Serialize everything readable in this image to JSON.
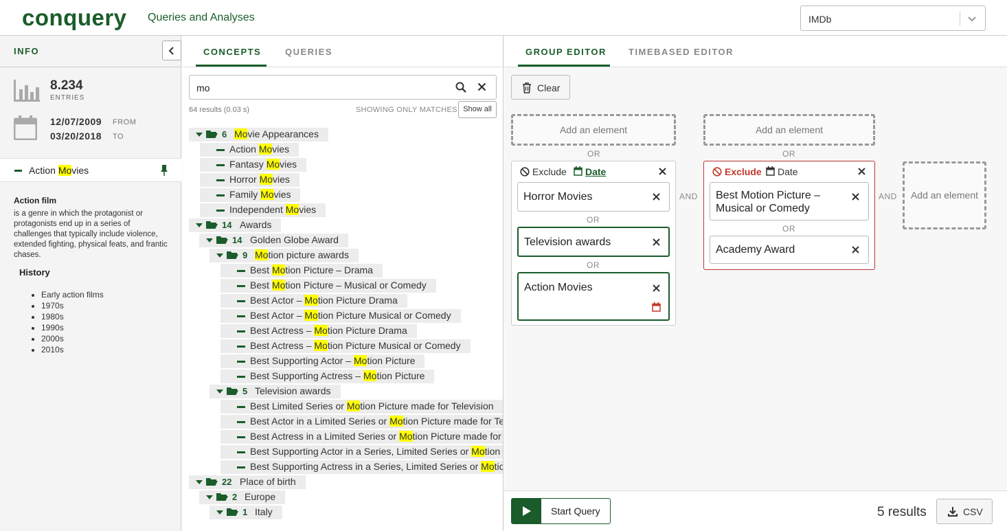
{
  "header": {
    "logo": "conquery",
    "title": "Queries and Analyses",
    "dataset": "IMDb"
  },
  "info": {
    "title": "INFO",
    "entries_value": "8.234",
    "entries_label": "ENTRIES",
    "date_from": "12/07/2009",
    "date_from_label": "FROM",
    "date_to": "03/20/2018",
    "date_to_label": "TO",
    "concept_pre": "Action ",
    "concept_hl": "Mo",
    "concept_post": "vies",
    "desc_title": "Action film",
    "desc_text": "is a genre in which the protagonist or protagonists end up in a series of challenges that typically include violence, extended fighting, physical feats, and frantic chases.",
    "history_title": "History",
    "history_items": [
      "Early action films",
      "1970s",
      "1980s",
      "1990s",
      "2000s",
      "2010s"
    ]
  },
  "concepts": {
    "tabs": [
      "CONCEPTS",
      "QUERIES"
    ],
    "search_value": "mo",
    "results_info": "64 results (0.03 s)",
    "showing_only": "SHOWING ONLY MATCHES",
    "show_all": "Show all",
    "tree": [
      {
        "type": "folder",
        "indent": 0,
        "count": "6",
        "pre": "",
        "hl": "Mo",
        "post": "vie Appearances"
      },
      {
        "type": "leaf",
        "indent": 1,
        "pre": "Action ",
        "hl": "Mo",
        "post": "vies"
      },
      {
        "type": "leaf",
        "indent": 1,
        "pre": "Fantasy ",
        "hl": "Mo",
        "post": "vies"
      },
      {
        "type": "leaf",
        "indent": 1,
        "pre": "Horror ",
        "hl": "Mo",
        "post": "vies"
      },
      {
        "type": "leaf",
        "indent": 1,
        "pre": "Family ",
        "hl": "Mo",
        "post": "vies"
      },
      {
        "type": "leaf",
        "indent": 1,
        "pre": "Independent ",
        "hl": "Mo",
        "post": "vies"
      },
      {
        "type": "folder",
        "indent": 0,
        "count": "14",
        "pre": "Awards",
        "hl": "",
        "post": ""
      },
      {
        "type": "folder",
        "indent": 1,
        "count": "14",
        "pre": "Golden Globe Award",
        "hl": "",
        "post": ""
      },
      {
        "type": "folder",
        "indent": 2,
        "count": "9",
        "pre": "",
        "hl": "Mo",
        "post": "tion picture awards"
      },
      {
        "type": "leaf",
        "indent": 3,
        "pre": "Best ",
        "hl": "Mo",
        "post": "tion Picture – Drama"
      },
      {
        "type": "leaf",
        "indent": 3,
        "pre": "Best ",
        "hl": "Mo",
        "post": "tion Picture – Musical or Comedy"
      },
      {
        "type": "leaf",
        "indent": 3,
        "pre": "Best Actor – ",
        "hl": "Mo",
        "post": "tion Picture Drama"
      },
      {
        "type": "leaf",
        "indent": 3,
        "pre": "Best Actor – ",
        "hl": "Mo",
        "post": "tion Picture Musical or Comedy"
      },
      {
        "type": "leaf",
        "indent": 3,
        "pre": "Best Actress – ",
        "hl": "Mo",
        "post": "tion Picture Drama"
      },
      {
        "type": "leaf",
        "indent": 3,
        "pre": "Best Actress – ",
        "hl": "Mo",
        "post": "tion Picture Musical or Comedy"
      },
      {
        "type": "leaf",
        "indent": 3,
        "pre": "Best Supporting Actor – ",
        "hl": "Mo",
        "post": "tion Picture"
      },
      {
        "type": "leaf",
        "indent": 3,
        "pre": "Best Supporting Actress – ",
        "hl": "Mo",
        "post": "tion Picture"
      },
      {
        "type": "folder",
        "indent": 2,
        "count": "5",
        "pre": "Television awards",
        "hl": "",
        "post": ""
      },
      {
        "type": "leaf",
        "indent": 3,
        "pre": "Best Limited Series or ",
        "hl": "Mo",
        "post": "tion Picture made for Television"
      },
      {
        "type": "leaf",
        "indent": 3,
        "pre": "Best Actor in a Limited Series or ",
        "hl": "Mo",
        "post": "tion Picture made for Television"
      },
      {
        "type": "leaf",
        "indent": 3,
        "pre": "Best Actress in a Limited Series or ",
        "hl": "Mo",
        "post": "tion Picture made for Television"
      },
      {
        "type": "leaf",
        "indent": 3,
        "pre": "Best Supporting Actor in a Series, Limited Series or ",
        "hl": "Mo",
        "post": "tion Picture"
      },
      {
        "type": "leaf",
        "indent": 3,
        "pre": "Best Supporting Actress in a Series, Limited Series or ",
        "hl": "Mo",
        "post": "tion Picture"
      },
      {
        "type": "folder",
        "indent": 0,
        "count": "22",
        "pre": "Place of birth",
        "hl": "",
        "post": ""
      },
      {
        "type": "folder",
        "indent": 1,
        "count": "2",
        "pre": "Europe",
        "hl": "",
        "post": ""
      },
      {
        "type": "folder",
        "indent": 2,
        "count": "1",
        "pre": "Italy",
        "hl": "",
        "post": ""
      }
    ]
  },
  "editor": {
    "tabs": [
      "GROUP EDITOR",
      "TIMEBASED EDITOR"
    ],
    "clear": "Clear",
    "add_element": "Add an element",
    "or": "OR",
    "and": "AND",
    "exclude": "Exclude",
    "date": "Date",
    "group1": [
      "Horror Movies",
      "Television awards",
      "Action Movies"
    ],
    "group2": [
      "Best Motion Picture – Musical or Comedy",
      "Academy Award"
    ],
    "start_query": "Start Query",
    "results": "5 results",
    "csv": "CSV"
  },
  "colors": {
    "brand": "#1a5c2a",
    "highlight": "#ffff00",
    "exclude": "#c0392b"
  }
}
